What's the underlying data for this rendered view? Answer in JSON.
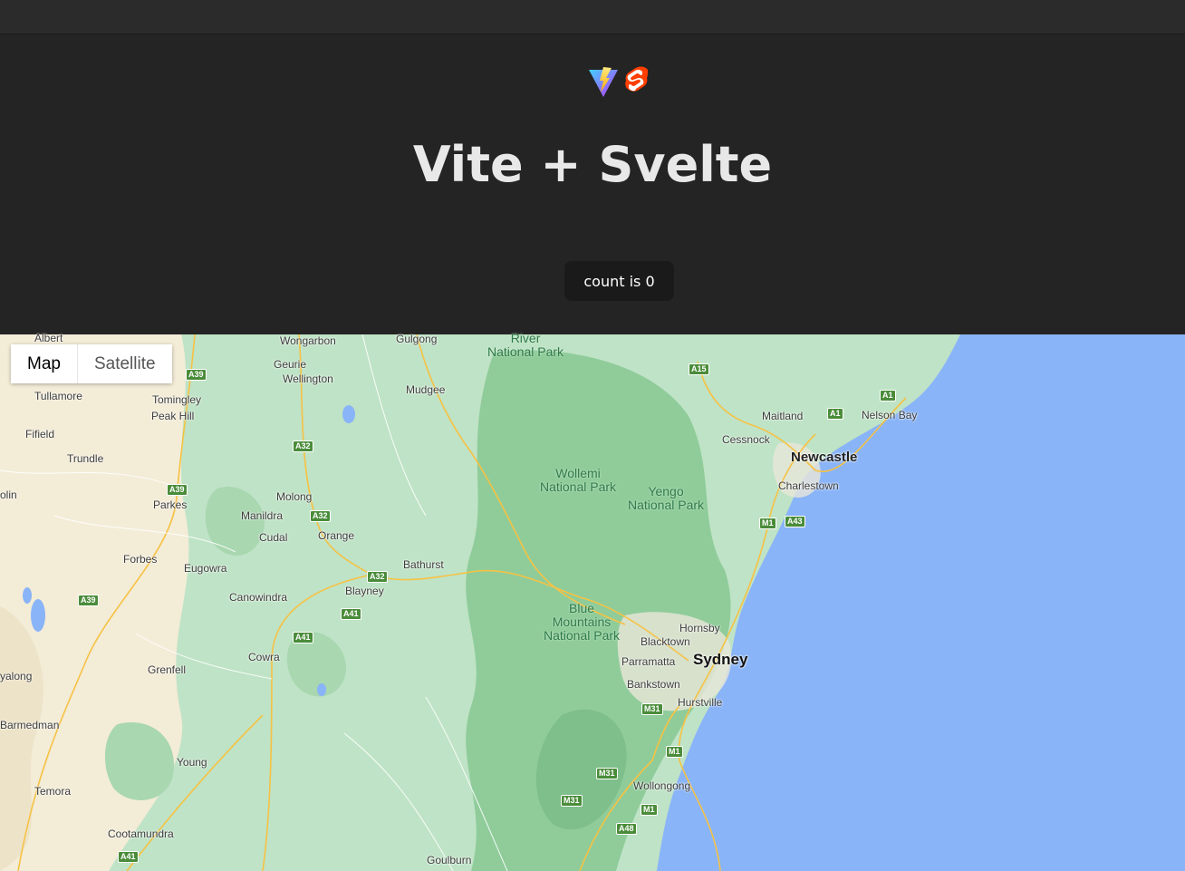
{
  "app": {
    "title": "Vite + Svelte",
    "count_label": "count is 0"
  },
  "logos": {
    "vite": "vite-logo",
    "svelte": "svelte-logo"
  },
  "map": {
    "map_types": {
      "map": "Map",
      "satellite": "Satellite"
    },
    "parks": {
      "river": "River\nNational Park",
      "wollemi": "Wollemi\nNational Park",
      "yengo": "Yengo\nNational Park",
      "blue_mountains": "Blue\nMountains\nNational Park"
    },
    "places": {
      "albert": "Albert",
      "wongarbon": "Wongarbon",
      "gulgong": "Gulgong",
      "geurie": "Geurie",
      "wellington": "Wellington",
      "mudgee": "Mudgee",
      "tullamore": "Tullamore",
      "tomingley": "Tomingley",
      "peak_hill": "Peak Hill",
      "fifield": "Fifield",
      "trundle": "Trundle",
      "molong": "Molong",
      "parkes": "Parkes",
      "manildra": "Manildra",
      "cudal": "Cudal",
      "orange": "Orange",
      "forbes": "Forbes",
      "eugowra": "Eugowra",
      "bathurst": "Bathurst",
      "blayney": "Blayney",
      "canowindra": "Canowindra",
      "cowra": "Cowra",
      "grenfell": "Grenfell",
      "young": "Young",
      "temora": "Temora",
      "cootamundra": "Cootamundra",
      "goulburn": "Goulburn",
      "maitland": "Maitland",
      "cessnock": "Cessnock",
      "newcastle": "Newcastle",
      "charlestown": "Charlestown",
      "nelson_bay": "Nelson Bay",
      "hornsby": "Hornsby",
      "blacktown": "Blacktown",
      "parramatta": "Parramatta",
      "sydney": "Sydney",
      "bankstown": "Bankstown",
      "hurstville": "Hurstville",
      "wollongong": "Wollongong",
      "olin": "olin",
      "yalong": "yalong",
      "barmedman": "Barmedman"
    },
    "roads": {
      "a39_1": "A39",
      "a39_2": "A39",
      "a39_3": "A39",
      "a32_1": "A32",
      "a32_2": "A32",
      "a32_3": "A32",
      "a41_1": "A41",
      "a41_2": "A41",
      "a41_3": "A41",
      "a15": "A15",
      "a1_1": "A1",
      "a1_2": "A1",
      "m1_1": "M1",
      "m1_2": "M1",
      "m1_3": "M1",
      "a43": "A43",
      "m31_1": "M31",
      "m31_2": "M31",
      "m31_3": "M31",
      "a48": "A48"
    }
  },
  "colors": {
    "land": "#bfe3c6",
    "water": "#8ab4f8",
    "dry": "#f3ecd7",
    "forest": "#8fcc9a",
    "road": "#f6c244"
  }
}
